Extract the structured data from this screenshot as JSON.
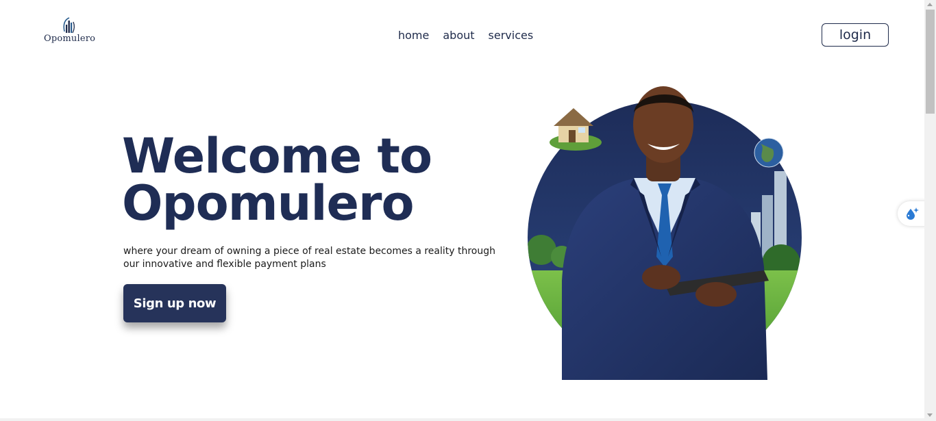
{
  "brand": {
    "name": "Opomulero"
  },
  "nav": {
    "home": "home",
    "about": "about",
    "services": "services"
  },
  "header": {
    "login_label": "login"
  },
  "hero": {
    "title_line1": "Welcome to",
    "title_line2": "Opomulero",
    "subtitle": "where your dream of owning a piece of real estate becomes a reality through our innovative and flexible payment plans",
    "cta_label": "Sign up now"
  },
  "colors": {
    "brand_navy": "#26335a",
    "title_navy": "#1f2d55",
    "circle_bg": "#1e2e5c"
  },
  "icons": {
    "side_widget": "water-drop-sparkle-icon"
  }
}
